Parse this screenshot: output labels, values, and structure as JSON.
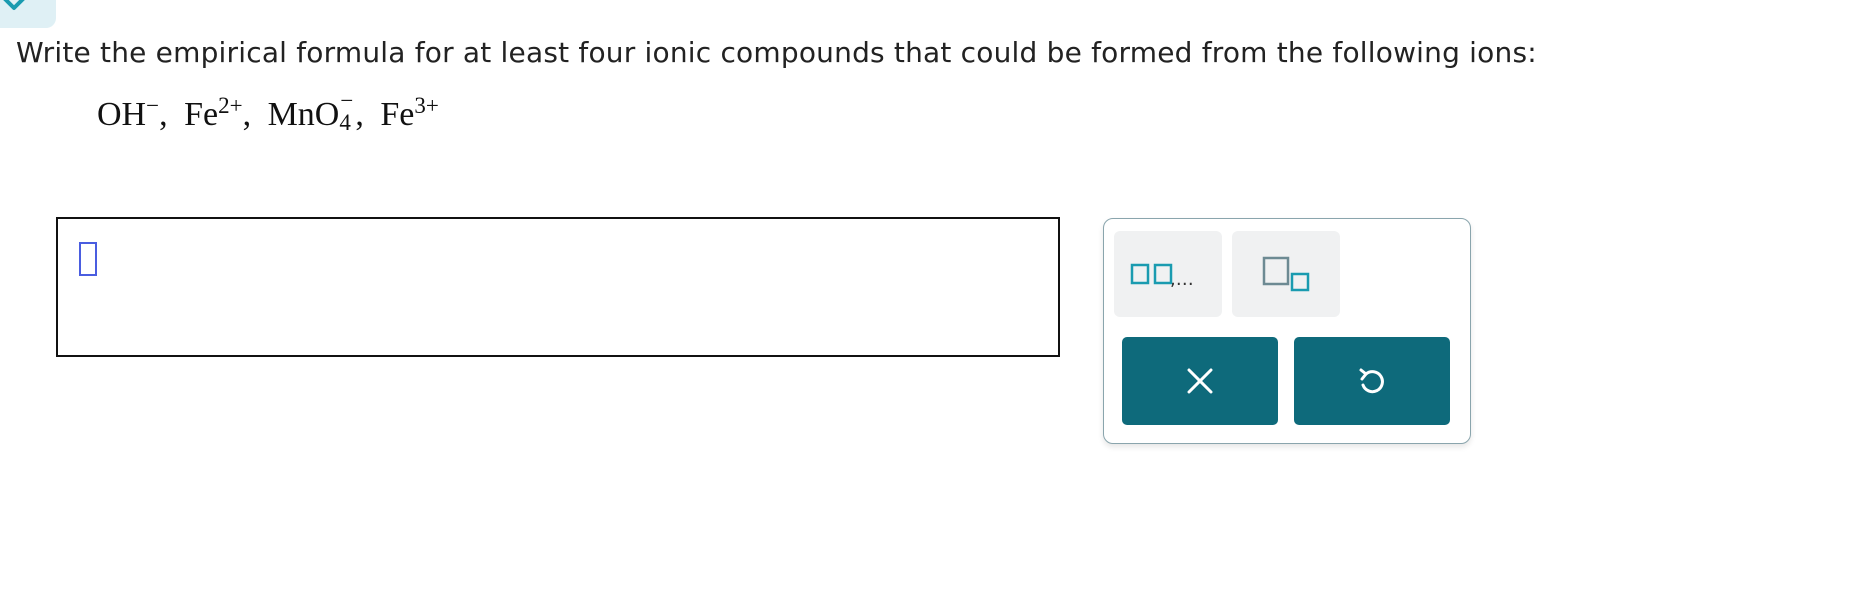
{
  "question": {
    "text": "Write the empirical formula for at least four ionic compounds that could be formed from the following ions:"
  },
  "ions": [
    {
      "base": "OH",
      "subscript": "",
      "charge": "−"
    },
    {
      "base": "Fe",
      "subscript": "",
      "charge": "2+"
    },
    {
      "base": "MnO",
      "subscript": "4",
      "charge": "−"
    },
    {
      "base": "Fe",
      "subscript": "",
      "charge": "3+"
    }
  ],
  "separator": ",",
  "palette": {
    "list_tool_icon": "list-of-boxes-icon",
    "list_tool_text": ",…",
    "subscript_tool_icon": "subscript-box-icon",
    "clear_icon": "close-icon",
    "undo_icon": "undo-icon"
  },
  "colors": {
    "accent": "#0e6a7b",
    "cursor": "#4a5de0",
    "icon_teal": "#1a9bb0"
  }
}
